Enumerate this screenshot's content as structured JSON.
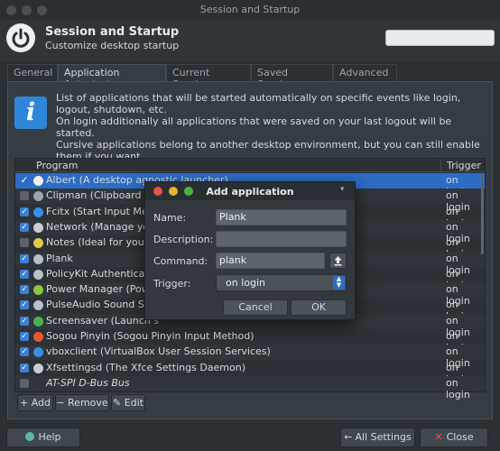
{
  "window": {
    "title": "Session and Startup"
  },
  "header": {
    "title": "Session and Startup",
    "subtitle": "Customize desktop startup"
  },
  "tabs": [
    {
      "label": "General"
    },
    {
      "label": "Application Autostart"
    },
    {
      "label": "Current Session"
    },
    {
      "label": "Saved Sessions"
    },
    {
      "label": "Advanced"
    }
  ],
  "info": {
    "line1": "List of applications that will be started automatically on specific events like login, logout, shutdown, etc.",
    "line2": "On login additionally all applications that were saved on your last logout will be started.",
    "line3": "Cursive applications belong to another desktop environment, but you can still enable them if you want."
  },
  "table": {
    "columns": [
      "Program",
      "Trigger"
    ],
    "rows": [
      {
        "name": "Albert (A desktop agnostic launcher)",
        "trigger": "on login",
        "checked": true,
        "selected": true,
        "icon_color": "#f0f0f0"
      },
      {
        "name": "Clipman (Clipboard m",
        "trigger": "on login",
        "checked": false,
        "icon_color": "#9aa5b0"
      },
      {
        "name": "Fcitx (Start Input Meth",
        "trigger": "on login",
        "checked": true,
        "icon_color": "#3a8ee6"
      },
      {
        "name": "Network (Manage you",
        "trigger": "on login",
        "checked": true,
        "icon_color": "#c9cdd1"
      },
      {
        "name": "Notes (Ideal for your d",
        "trigger": "on login",
        "checked": false,
        "icon_color": "#e6c84a"
      },
      {
        "name": "Plank",
        "trigger": "on login",
        "checked": true,
        "icon_color": "#b8c0c8"
      },
      {
        "name": "PolicyKit Authenticatio",
        "trigger": "on login",
        "checked": true,
        "icon_color": "#b8c0c8"
      },
      {
        "name": "Power Manager (Powe",
        "trigger": "on login",
        "checked": true,
        "icon_color": "#8dc63f"
      },
      {
        "name": "PulseAudio Sound Sys",
        "trigger": "on login",
        "checked": true,
        "icon_color": "#b8c0c8"
      },
      {
        "name": "Screensaver (Launch s",
        "trigger": "on login",
        "checked": true,
        "icon_color": "#4caf50"
      },
      {
        "name": "Sogou Pinyin (Sogou Pinyin Input Method)",
        "trigger": "on login",
        "checked": true,
        "icon_color": "#e8552f"
      },
      {
        "name": "vboxclient (VirtualBox User Session Services)",
        "trigger": "on login",
        "checked": true,
        "icon_color": "#3a8ee6"
      },
      {
        "name": "Xfsettingsd (The Xfce Settings Daemon)",
        "trigger": "on login",
        "checked": true,
        "icon_color": "#c9cdd1"
      },
      {
        "name": "AT-SPI D-Bus Bus",
        "trigger": "on login",
        "checked": false,
        "italic": true,
        "icon_color": ""
      }
    ]
  },
  "actions": {
    "add": "+ Add",
    "remove": "− Remove",
    "edit": "✎ Edit"
  },
  "footer": {
    "help": "Help",
    "all_settings": "All Settings",
    "close": "Close"
  },
  "dialog": {
    "title": "Add application",
    "name_label": "Name:",
    "name_value": "Plank",
    "description_label": "Description:",
    "description_value": "",
    "command_label": "Command:",
    "command_value": "plank",
    "trigger_label": "Trigger:",
    "trigger_value": "on login",
    "cancel": "Cancel",
    "ok": "OK"
  },
  "colors": {
    "accent": "#2d6cc4",
    "checkbox": "#3c7fd5",
    "info": "#2f86d8"
  }
}
